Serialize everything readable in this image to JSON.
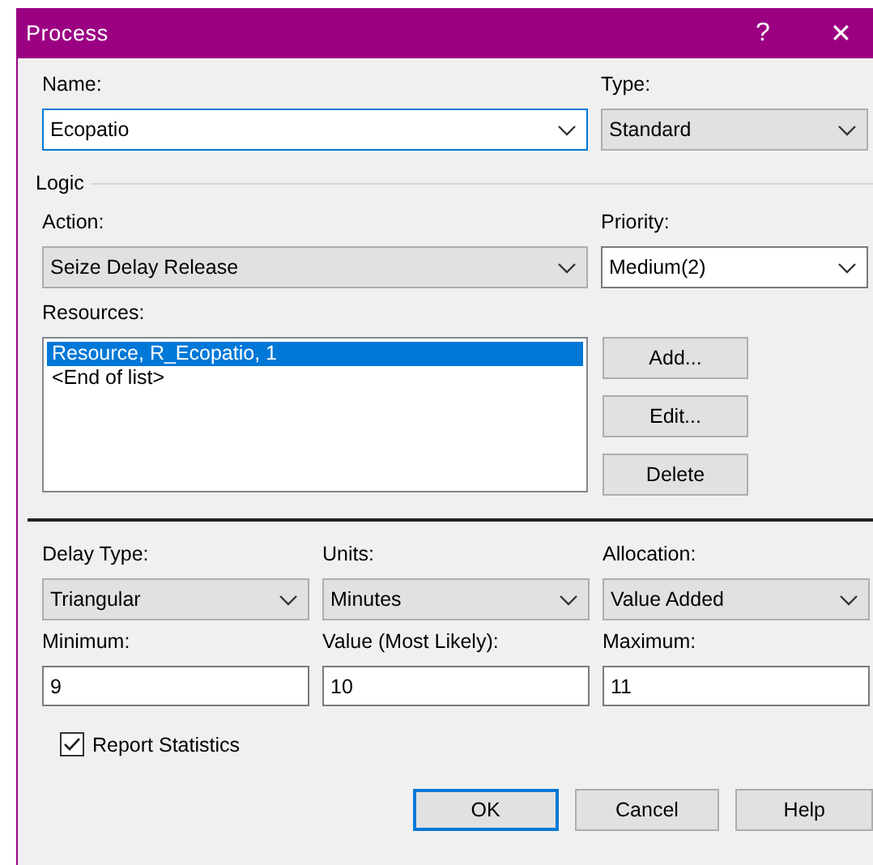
{
  "window": {
    "title": "Process",
    "help": "?",
    "close": "✕"
  },
  "name": {
    "label": "Name:",
    "value": "Ecopatio",
    "editable": true,
    "focused": true
  },
  "type": {
    "label": "Type:",
    "value": "Standard",
    "editable": false,
    "focused": false
  },
  "logic": {
    "title": "Logic",
    "action": {
      "label": "Action:",
      "value": "Seize Delay Release",
      "editable": false,
      "focused": false
    },
    "priority": {
      "label": "Priority:",
      "value": "Medium(2)",
      "editable": true,
      "focused": false
    },
    "resources": {
      "label": "Resources:",
      "items": [
        {
          "text": "Resource, R_Ecopatio, 1",
          "selected": true
        },
        {
          "text": "<End of list>",
          "selected": false
        }
      ]
    },
    "buttons": [
      "Add...",
      "Edit...",
      "Delete"
    ]
  },
  "delay": {
    "combos": [
      {
        "label": "Delay Type:",
        "value": "Triangular",
        "editable": false,
        "focused": false
      },
      {
        "label": "Units:",
        "value": "Minutes",
        "editable": false,
        "focused": false
      },
      {
        "label": "Allocation:",
        "value": "Value Added",
        "editable": false,
        "focused": false
      }
    ],
    "fields": [
      {
        "label": "Minimum:",
        "value": "9"
      },
      {
        "label": "Value (Most Likely):",
        "value": "10"
      },
      {
        "label": "Maximum:",
        "value": "11"
      }
    ]
  },
  "report_statistics": {
    "label": "Report Statistics",
    "checked": true
  },
  "buttons": [
    {
      "label": "OK",
      "default": true
    },
    {
      "label": "Cancel",
      "default": false
    },
    {
      "label": "Help",
      "default": false
    }
  ]
}
